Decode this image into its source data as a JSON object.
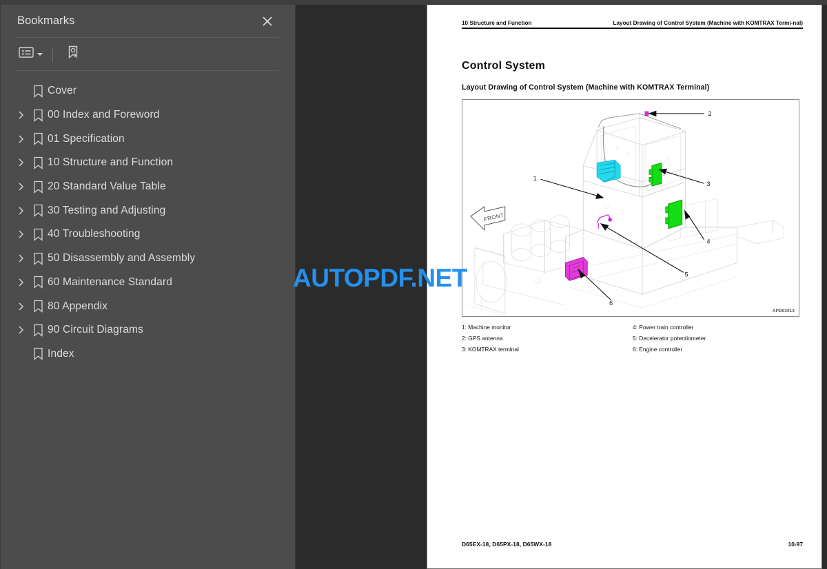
{
  "sidebar": {
    "title": "Bookmarks",
    "close_icon": "close-icon",
    "toolbar": {
      "list_options_icon": "list-options-icon",
      "dropdown_caret_icon": "chevron-down-icon",
      "new_bookmark_icon": "new-bookmark-icon"
    },
    "items": [
      {
        "label": "Cover",
        "expandable": false
      },
      {
        "label": "00 Index and Foreword",
        "expandable": true
      },
      {
        "label": "01 Specification",
        "expandable": true
      },
      {
        "label": "10 Structure and Function",
        "expandable": true
      },
      {
        "label": "20 Standard Value Table",
        "expandable": true
      },
      {
        "label": "30 Testing and Adjusting",
        "expandable": true
      },
      {
        "label": "40 Troubleshooting",
        "expandable": true
      },
      {
        "label": "50 Disassembly and Assembly",
        "expandable": true
      },
      {
        "label": "60 Maintenance Standard",
        "expandable": true
      },
      {
        "label": "80 Appendix",
        "expandable": true
      },
      {
        "label": "90 Circuit Diagrams",
        "expandable": true
      },
      {
        "label": "Index",
        "expandable": false
      }
    ]
  },
  "document": {
    "header_left": "10 Structure and Function",
    "header_right": "Layout Drawing of Control System (Machine with KOMTRAX Termi-nal)",
    "heading": "Control System",
    "subheading": "Layout Drawing of Control System (Machine with KOMTRAX Terminal)",
    "figure": {
      "code": "APD03013",
      "direction_label": "FRONT",
      "callouts": [
        "1",
        "2",
        "3",
        "4",
        "5",
        "6"
      ]
    },
    "legend": {
      "left": [
        "1: Machine monitor",
        "2: GPS antenna",
        "3: KOMTRAX terminal"
      ],
      "right": [
        "4: Power train controller",
        "5: Decelerator potentiometer",
        "6: Engine controller"
      ]
    },
    "footer_left": "D65EX-18, D65PX-18, D65WX-18",
    "footer_right": "10-97"
  },
  "watermark": {
    "text": "AUTOPDF.NET",
    "color": "#2590ec"
  },
  "colors": {
    "sidebar_bg": "#4c4c4c",
    "viewer_bg": "#2b2b2b",
    "page_bg": "#ffffff",
    "text_light": "#dcdcdc",
    "part_cyan": "#23d3e8",
    "part_green": "#12d912",
    "part_magenta": "#e038d8"
  }
}
